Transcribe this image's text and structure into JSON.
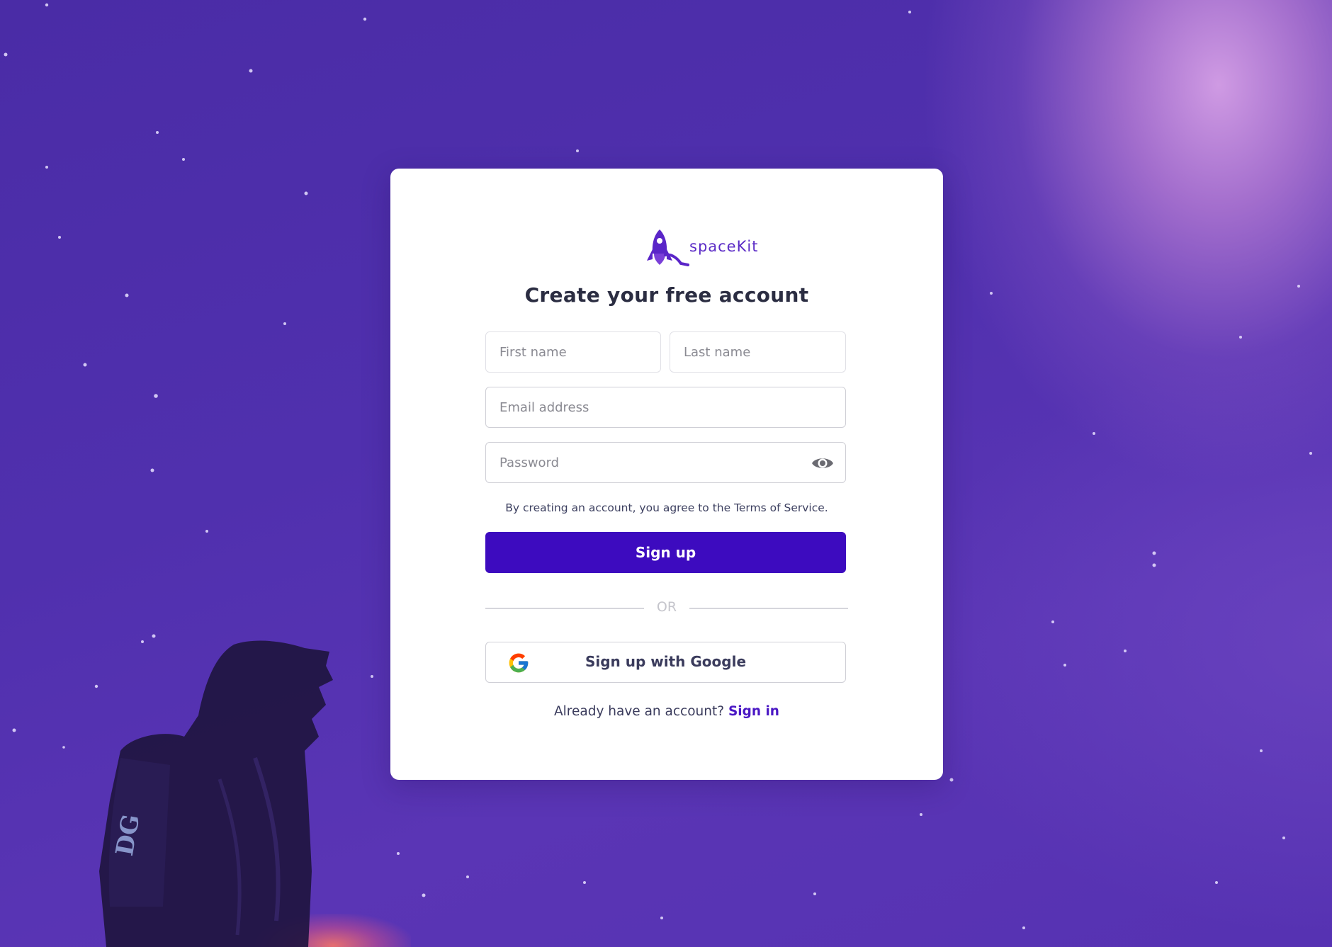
{
  "brand": {
    "name": "spaceKit",
    "logo_icon": "rocket-icon",
    "accent_color": "#3d0bbf"
  },
  "form": {
    "title": "Create your free account",
    "first_name_placeholder": "First name",
    "last_name_placeholder": "Last name",
    "email_placeholder": "Email address",
    "password_placeholder": "Password",
    "password_toggle_icon": "eye-icon",
    "terms_text": "By creating an account, you agree to the Terms of Service.",
    "submit_label": "Sign up",
    "divider_label": "OR",
    "google_label": "Sign up with Google",
    "google_icon": "google-icon",
    "have_account_text": "Already have an account?",
    "signin_label": "Sign in"
  }
}
